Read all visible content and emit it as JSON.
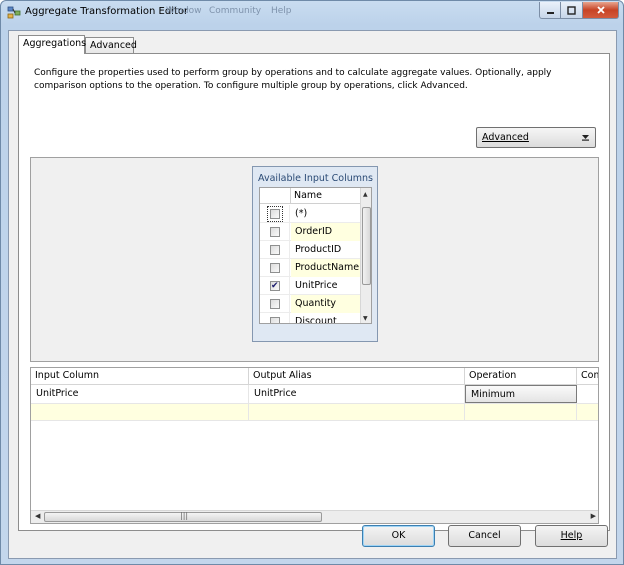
{
  "window": {
    "title": "Aggregate Transformation Editor",
    "ghost_menu": [
      "Window",
      "Community",
      "Help"
    ]
  },
  "tabs": [
    {
      "label": "Aggregations",
      "active": true
    },
    {
      "label": "Advanced",
      "active": false
    }
  ],
  "description": "Configure the properties used to perform group by operations and to calculate aggregate values. Optionally, apply comparison options to the operation. To configure multiple group by operations, click Advanced.",
  "advanced_toggle": {
    "label": "Advanced"
  },
  "available_columns": {
    "title": "Available Input Columns",
    "header": "Name",
    "rows": [
      {
        "name": "(*)",
        "checked": false
      },
      {
        "name": "OrderID",
        "checked": false
      },
      {
        "name": "ProductID",
        "checked": false
      },
      {
        "name": "ProductName",
        "checked": false
      },
      {
        "name": "UnitPrice",
        "checked": true
      },
      {
        "name": "Quantity",
        "checked": false
      },
      {
        "name": "Discount",
        "checked": false
      }
    ]
  },
  "output_grid": {
    "headers": [
      "Input Column",
      "Output Alias",
      "Operation",
      "Com"
    ],
    "rows": [
      {
        "input_column": "UnitPrice",
        "output_alias": "UnitPrice",
        "operation": "Minimum"
      }
    ]
  },
  "buttons": {
    "ok": "OK",
    "cancel": "Cancel",
    "help": "Help"
  },
  "colors": {
    "titlebar": "#bcd2ea",
    "close": "#c74426",
    "new_row": "#ffffe0",
    "column_box": "#dfe8f3"
  }
}
